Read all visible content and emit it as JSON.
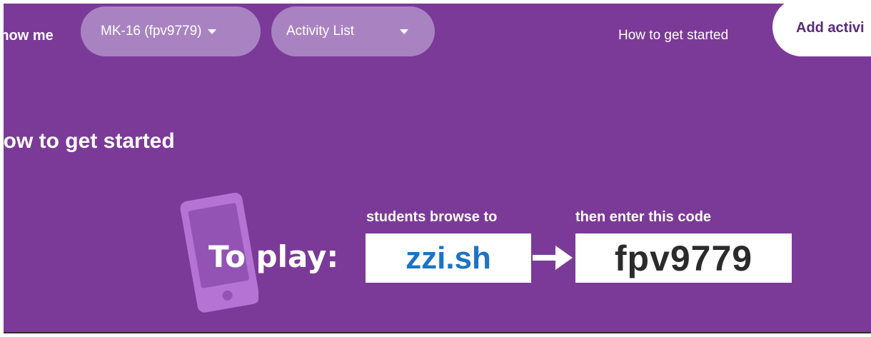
{
  "header": {
    "show_me_label": "Show me",
    "session_select": {
      "value": "MK-16 (fpv9779)",
      "icon": "chevron-down-icon"
    },
    "view_select": {
      "value": "Activity List",
      "icon": "chevron-down-icon"
    },
    "how_to_link": "How to get started",
    "add_activity_button": "Add activi"
  },
  "main": {
    "section_title": "How to get started",
    "to_play_label": "To play:",
    "browse_label": "students browse to",
    "url": "zzi.sh",
    "enter_code_label": "then enter this code",
    "code": "fpv9779",
    "icons": [
      "tablet-icon",
      "arrow-right-icon"
    ]
  },
  "colors": {
    "background": "#7b3a98",
    "pill": "#a983c1",
    "url_text": "#1a73c6",
    "code_text": "#2b2b2b",
    "tablet_frame": "#b573d4"
  }
}
